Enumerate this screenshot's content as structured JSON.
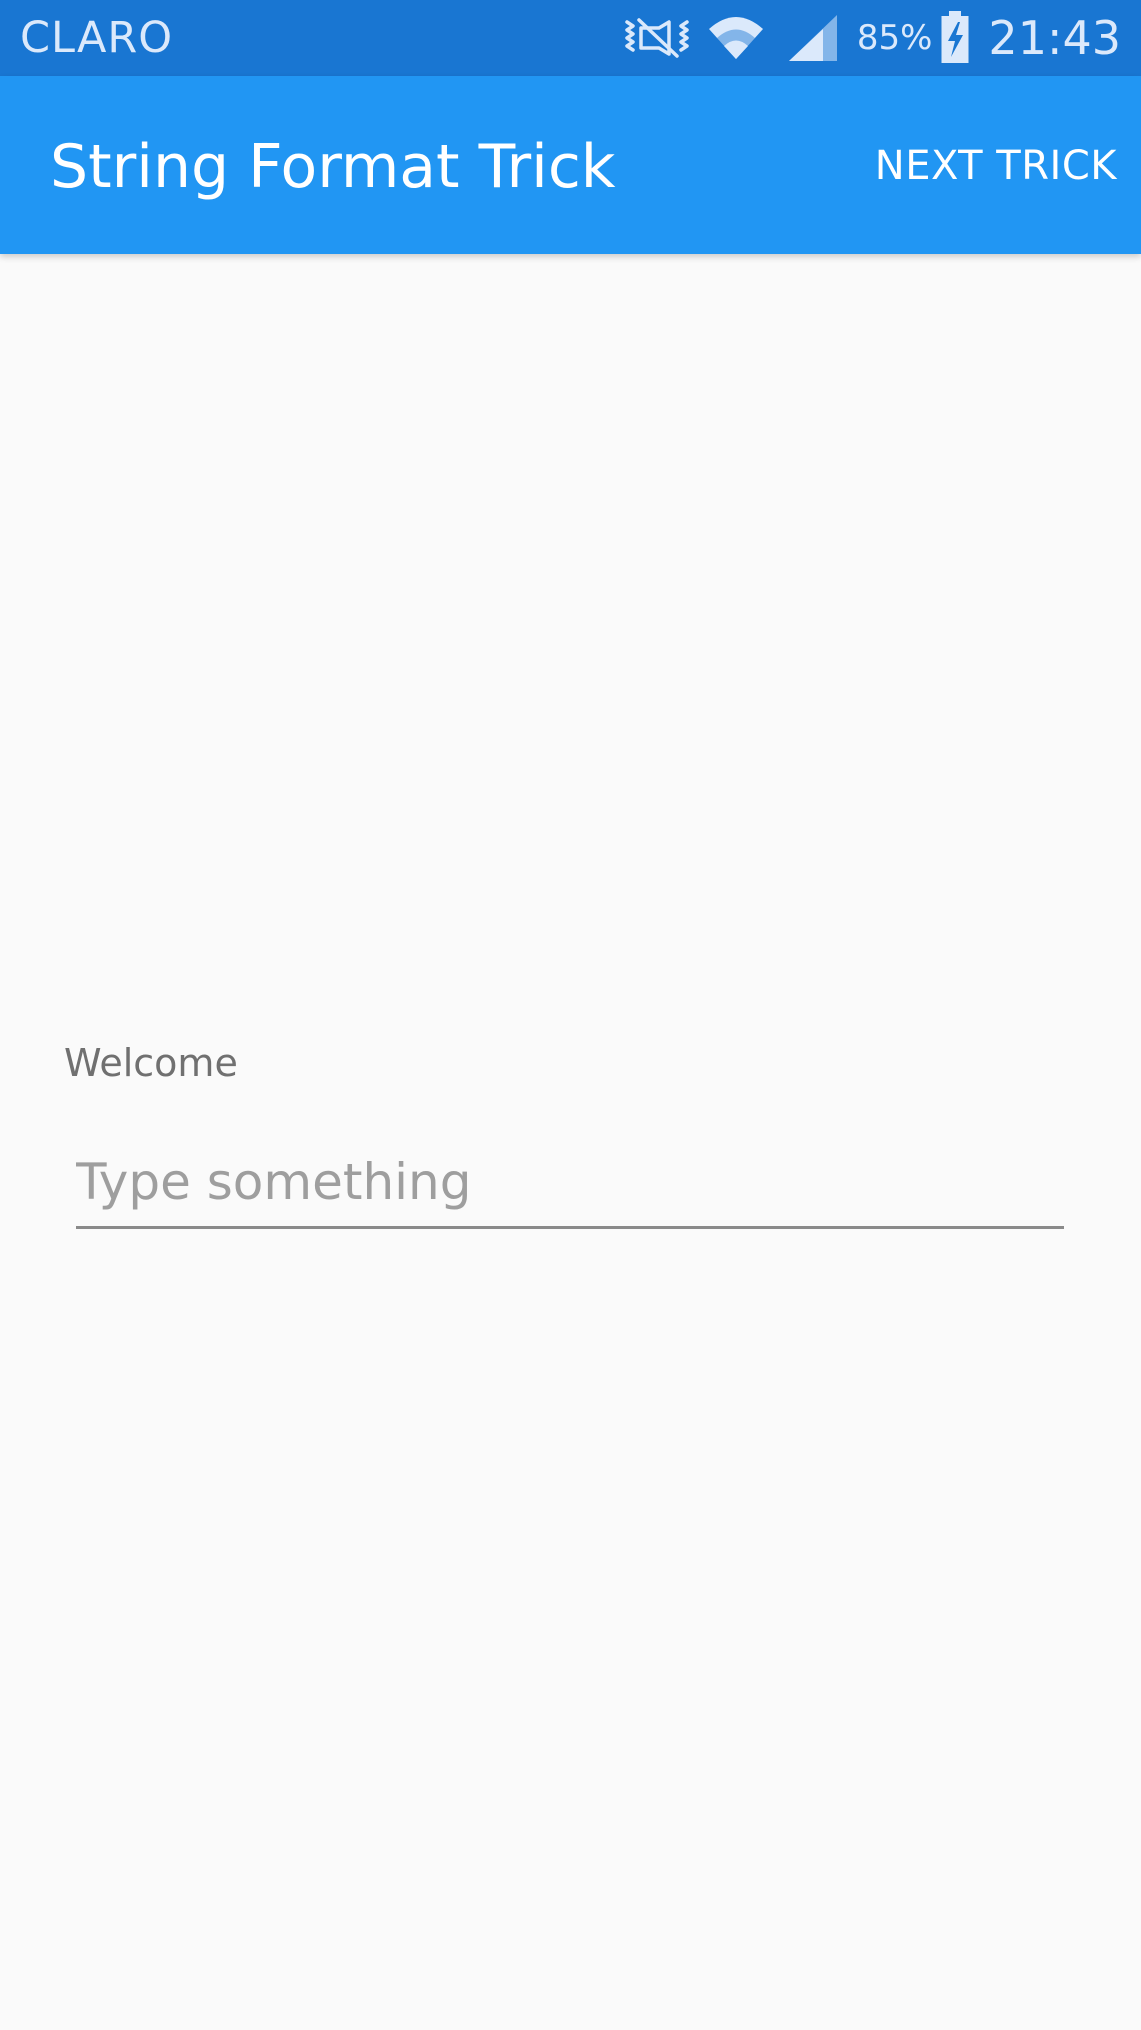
{
  "status_bar": {
    "carrier": "CLARO",
    "battery_percent": "85%",
    "time": "21:43",
    "icons": [
      "vibrate-mute-icon",
      "wifi-icon",
      "cell-signal-icon",
      "battery-charging-icon"
    ]
  },
  "app_bar": {
    "title": "String Format Trick",
    "action_label": "NEXT TRICK",
    "color": "#2196f3"
  },
  "main": {
    "welcome_label": "Welcome",
    "input": {
      "placeholder": "Type something",
      "value": ""
    }
  },
  "colors": {
    "status_bar": "#1976d2",
    "background": "#fafafa"
  }
}
